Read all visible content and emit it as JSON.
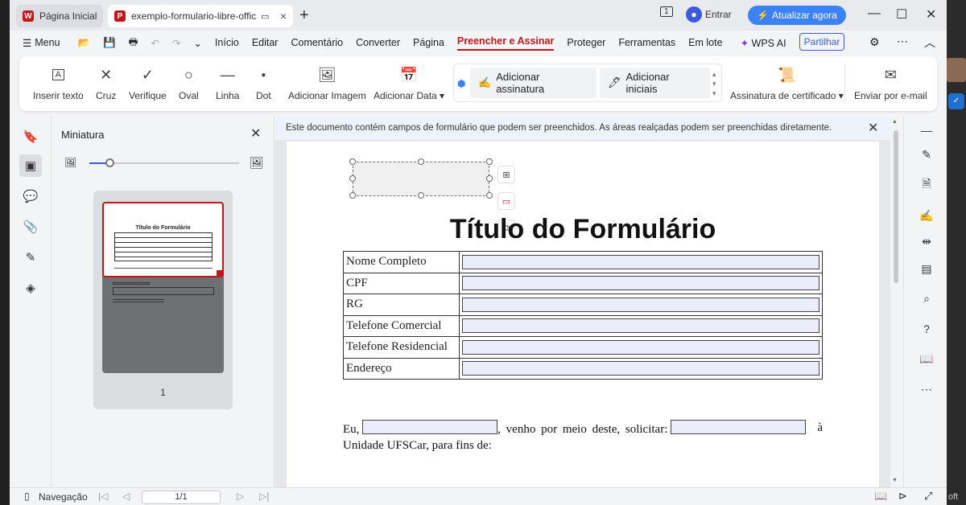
{
  "tabs": {
    "home": "Página Inicial",
    "doc": "exemplo-formulario-libre-offic"
  },
  "titlebar": {
    "signin": "Entrar",
    "update": "Atualizar agora"
  },
  "menu": {
    "menu_label": "Menu",
    "items": [
      "Início",
      "Editar",
      "Comentário",
      "Converter",
      "Página",
      "Preencher e Assinar",
      "Proteger",
      "Ferramentas",
      "Em lote"
    ],
    "active": "Preencher e Assinar",
    "wps_ai": "WPS AI",
    "share": "Partilhar"
  },
  "ribbon": {
    "insert_text": "Inserir texto",
    "cross": "Cruz",
    "check": "Verifique",
    "oval": "Oval",
    "line": "Linha",
    "dot": "Dot",
    "add_image": "Adicionar Imagem",
    "add_date": "Adicionar Data",
    "add_signature": "Adicionar assinatura",
    "add_initials": "Adicionar iniciais",
    "cert_signature": "Assinatura de certificado",
    "send_email": "Enviar por e-mail"
  },
  "thumbnail": {
    "title": "Miniatura",
    "page_num": "1",
    "mini_title": "Título do Formulário"
  },
  "notice": "Este documento contém campos de formulário que podem ser preenchidos. As áreas realçadas podem ser preenchidas diretamente.",
  "document": {
    "title": "Título do Formulário",
    "fields": [
      "Nome Completo",
      "CPF",
      "RG",
      "Telefone Comercial",
      "Telefone Residencial",
      "Endereço"
    ],
    "para_1": "Eu,",
    "para_2": ", venho por meio deste, solicitar:",
    "para_3": "à",
    "para_4": "Unidade UFSCar, para fins de:"
  },
  "status": {
    "nav": "Navegação",
    "page": "1/1"
  },
  "desktop": {
    "badge": "✓",
    "right_text": "oft"
  },
  "colors": {
    "accent_red": "#c4151c",
    "update_blue": "#3b82f6",
    "field_bg": "#ecedfb"
  }
}
